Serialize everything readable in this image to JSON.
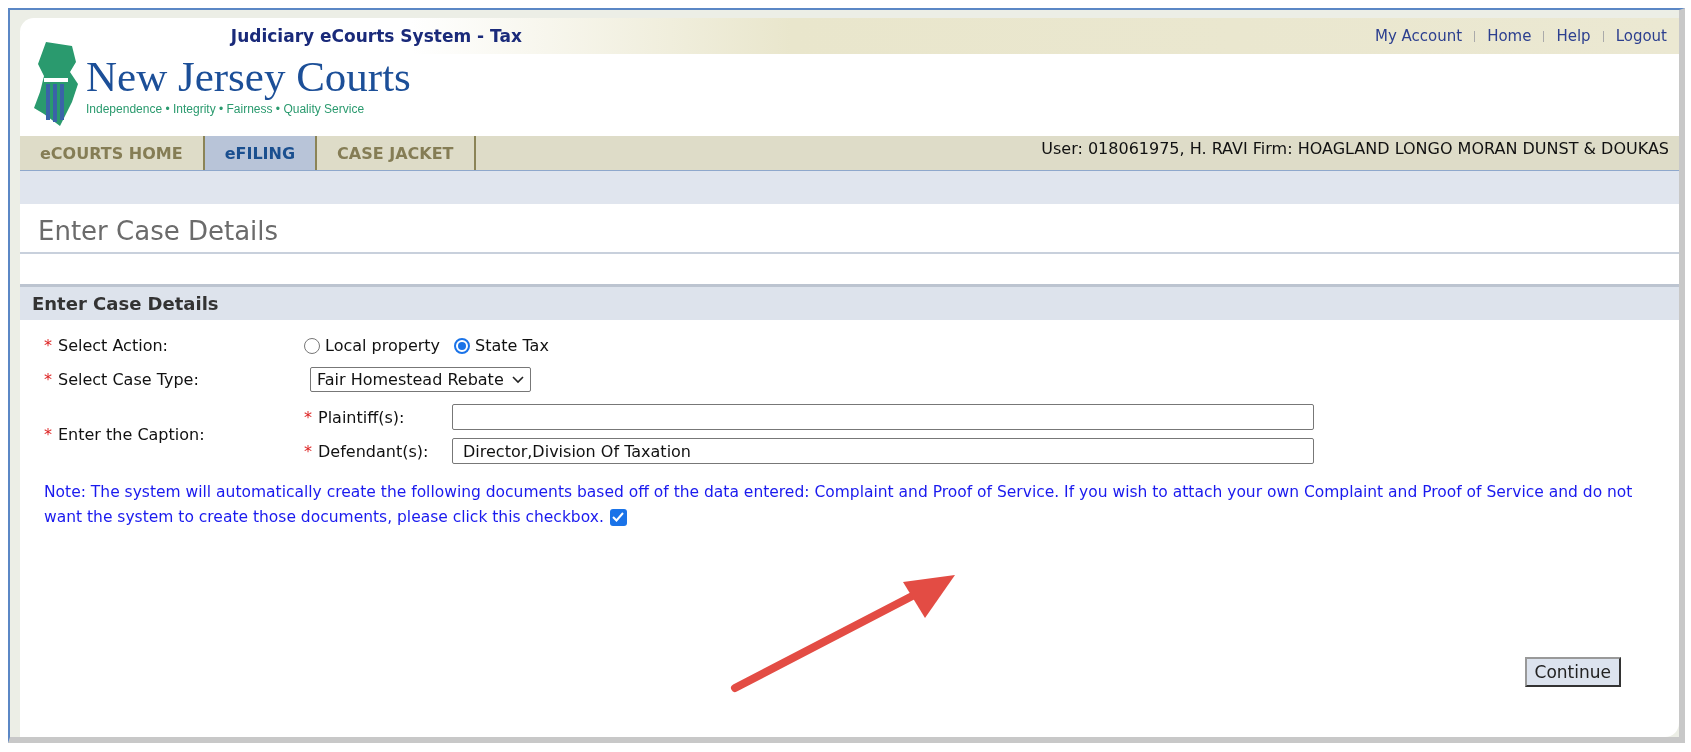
{
  "header": {
    "system_title": "Judiciary eCourts System - Tax",
    "links": [
      "My Account",
      "Home",
      "Help",
      "Logout"
    ],
    "logo_name": "New Jersey Courts",
    "logo_tagline": "Independence • Integrity • Fairness • Quality Service"
  },
  "tabs": [
    {
      "label": "eCOURTS HOME",
      "selected": false
    },
    {
      "label": "eFILING",
      "selected": true
    },
    {
      "label": "CASE JACKET",
      "selected": false
    }
  ],
  "user_info": "User: 018061975, H. RAVI  Firm: HOAGLAND LONGO MORAN DUNST & DOUKAS",
  "page_title": "Enter Case Details",
  "section": {
    "title": "Enter Case Details",
    "action": {
      "required_mark": "*",
      "label": "Select Action:",
      "options": [
        {
          "label": "Local property",
          "selected": false
        },
        {
          "label": "State Tax",
          "selected": true
        }
      ]
    },
    "case_type": {
      "required_mark": "*",
      "label": "Select Case Type:",
      "value": "Fair Homestead Rebate"
    },
    "caption": {
      "required_mark": "*",
      "label": "Enter the Caption:",
      "fields": [
        {
          "required_mark": "*",
          "label": "Plaintiff(s):"
        },
        {
          "required_mark": "*",
          "label": "Defendant(s):",
          "value": "Director,Division Of Taxation"
        }
      ]
    },
    "note": "Note: The system will automatically create the following documents based off of the data entered: Complaint and Proof of Service. If you wish to attach your own Complaint and Proof of Service and do not want the system to create those documents, please click this checkbox.",
    "own_documents_checked": true,
    "continue_button": "Continue"
  }
}
